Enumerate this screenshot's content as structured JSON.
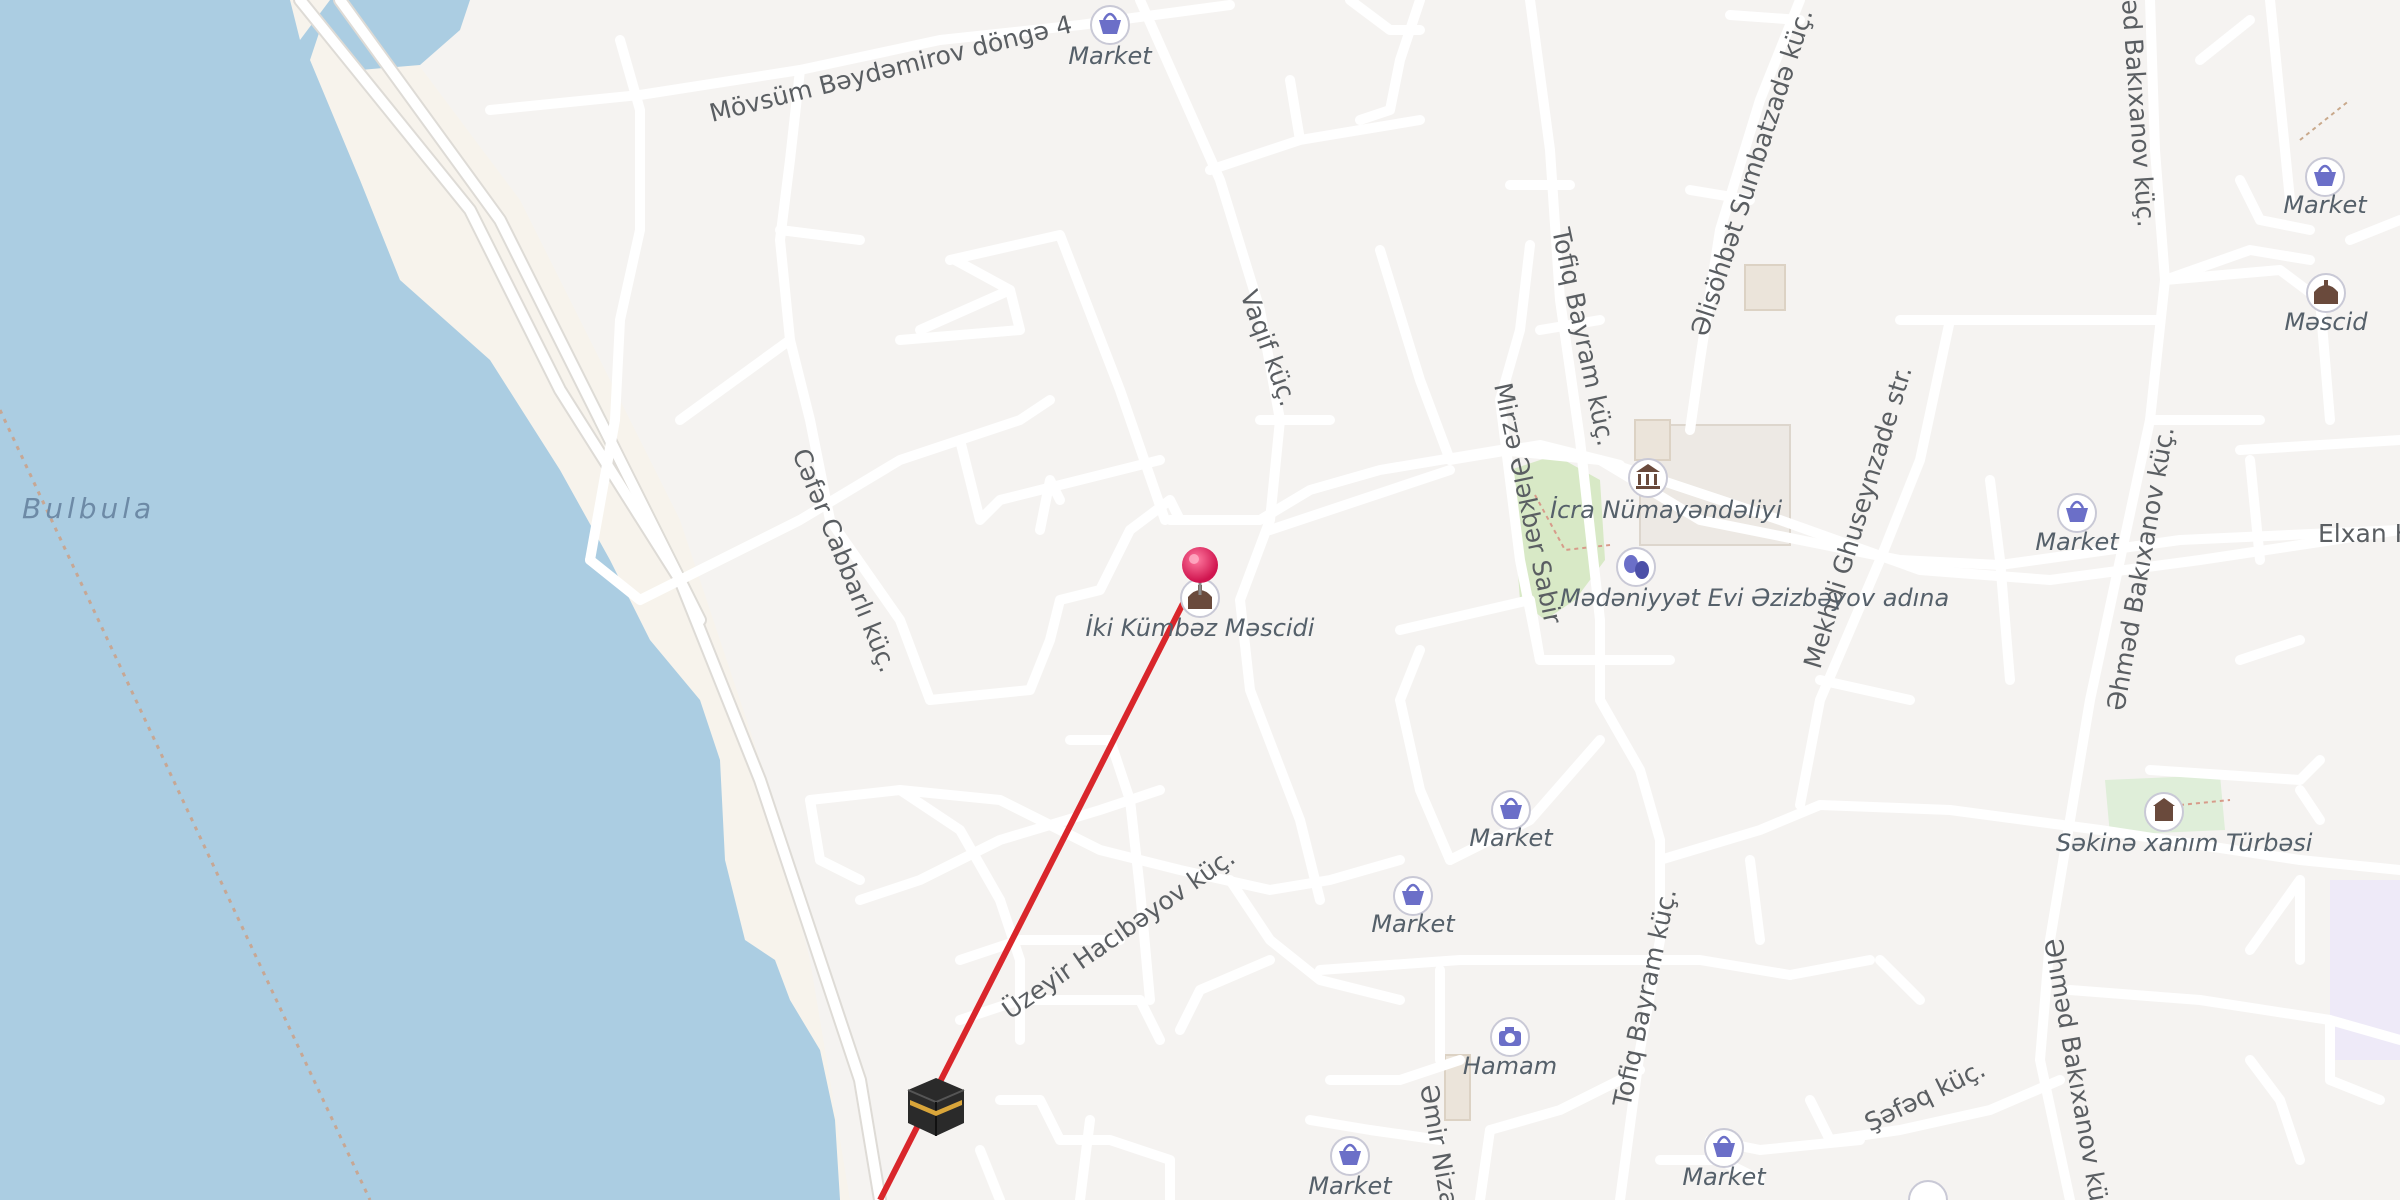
{
  "map": {
    "water_label": "Bulbula",
    "streets": [
      "Mövsüm Bəydəmirov döngə 4",
      "Vaqif küç.",
      "Cəfər Cabbarlı küç.",
      "Tofiq Bayram küç.",
      "Əlisöhbət Sumbatzadə küç.",
      "Mirzə Ələkbər Sabir",
      "Mekhdi Ghuseynzade str.",
      "Əhməd Bakıxanov küç.",
      "Elxan H",
      "Üzeyir Hacıbəyov küç.",
      "Tofiq Bayram küç.",
      "Əmir Niza",
      "Şəfəq küç.",
      "Əhməd Bakıxanov küç.",
      "əd Bakıxanov küç."
    ],
    "pois": [
      {
        "label": "Market",
        "icon": "basket-icon"
      },
      {
        "label": "Market",
        "icon": "basket-icon"
      },
      {
        "label": "Məscid",
        "icon": "mosque-icon"
      },
      {
        "label": "İcra Nümayəndəliyi",
        "icon": "government-building-icon"
      },
      {
        "label": "Market",
        "icon": "basket-icon"
      },
      {
        "label": "İki Kümbəz Məscidi",
        "icon": "mosque-icon"
      },
      {
        "label": "Mədəniyyət Evi Əzizbəyov adına",
        "icon": "theatre-masks-icon"
      },
      {
        "label": "Market",
        "icon": "basket-icon"
      },
      {
        "label": "Market",
        "icon": "basket-icon"
      },
      {
        "label": "Səkinə xanım Türbəsi",
        "icon": "mausoleum-icon"
      },
      {
        "label": "Hamam",
        "icon": "camera-icon"
      },
      {
        "label": "Market",
        "icon": "basket-icon"
      },
      {
        "label": "Market",
        "icon": "basket-icon"
      }
    ],
    "marker": {
      "icon": "location-pin-icon",
      "color": "#e0245e"
    },
    "qibla_icon": "kaaba-icon",
    "qibla_line_color": "#d9262b",
    "colors": {
      "water": "#abcde2",
      "land": "#f5f3f1",
      "beach": "#f7f3ec",
      "road": "#ffffff",
      "park": "#d8e9c6",
      "poi_icon": "#6b6fc8"
    }
  }
}
